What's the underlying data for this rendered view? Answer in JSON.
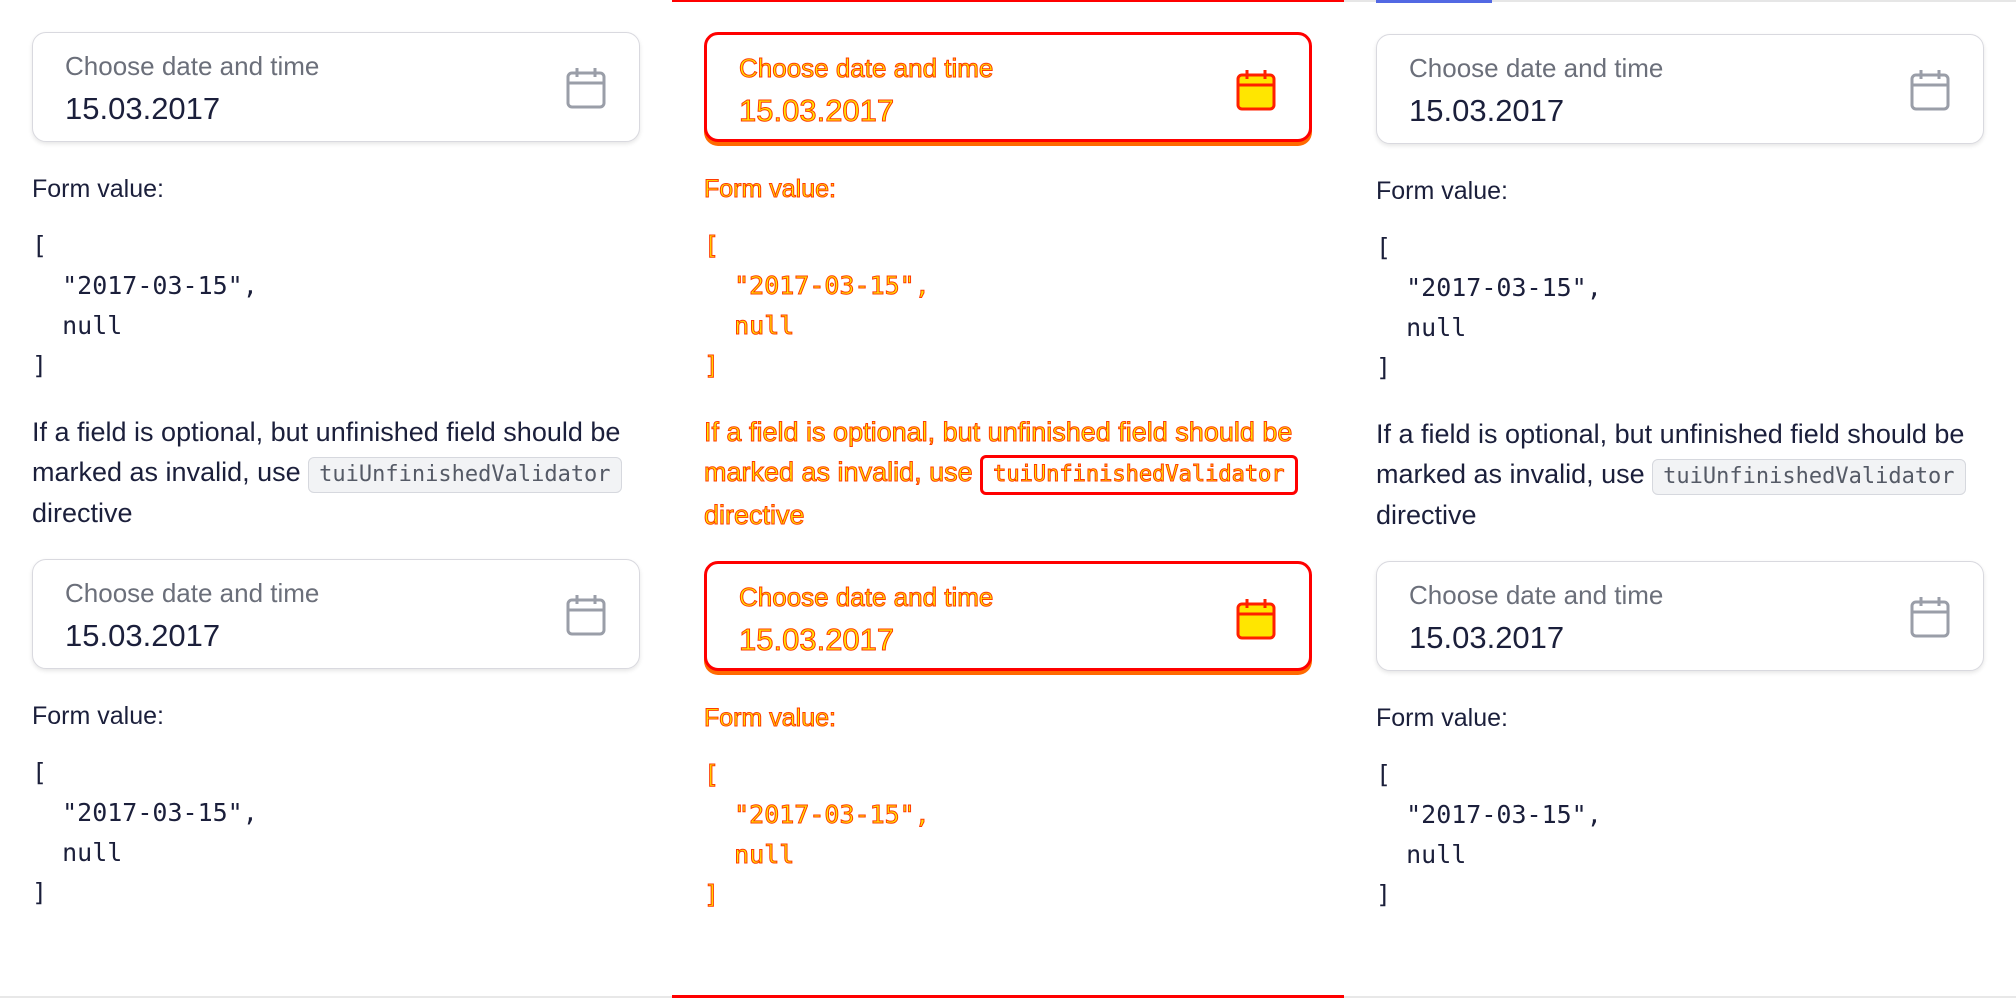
{
  "panels": [
    {
      "field1": {
        "label": "Choose date and time",
        "value": "15.03.2017",
        "icon": "calendar-icon"
      },
      "form_value_label": "Form value:",
      "json1": "[\n  \"2017-03-15\",\n  null\n]",
      "note_text": "If a field is optional, but unfinished field should be marked as invalid, use",
      "note_code": "tuiUnfinishedValidator",
      "note_suffix": "directive",
      "field2": {
        "label": "Choose date and time",
        "value": "15.03.2017",
        "icon": "calendar-icon"
      },
      "form_value_label2": "Form value:",
      "json2": "[\n  \"2017-03-15\",\n  null\n]"
    },
    {
      "field1": {
        "label": "Choose date and time",
        "value": "15.03.2017",
        "icon": "calendar-icon"
      },
      "form_value_label": "Form value:",
      "json1": "[\n  \"2017-03-15\",\n  null\n]",
      "note_text": "If a field is optional, but unfinished field should be marked as invalid, use",
      "note_code": "tuiUnfinishedValidator",
      "note_suffix": "directive",
      "field2": {
        "label": "Choose date and time",
        "value": "15.03.2017",
        "icon": "calendar-icon"
      },
      "form_value_label2": "Form value:",
      "json2": "[\n  \"2017-03-15\",\n  null\n]"
    },
    {
      "field1": {
        "label": "Choose date and time",
        "value": "15.03.2017",
        "icon": "calendar-icon"
      },
      "form_value_label": "Form value:",
      "json1": "[\n  \"2017-03-15\",\n  null\n]",
      "note_text": "If a field is optional, but unfinished field should be marked as invalid, use",
      "note_code": "tuiUnfinishedValidator",
      "note_suffix": "directive",
      "field2": {
        "label": "Choose date and time",
        "value": "15.03.2017",
        "icon": "calendar-icon"
      },
      "form_value_label2": "Form value:",
      "json2": "[\n  \"2017-03-15\",\n  null\n]"
    }
  ],
  "colors": {
    "accent": "#5268e3",
    "diff_red": "#ff0000",
    "diff_yellow": "#ffe600",
    "text": "#1b1f3b",
    "muted": "#6b6f7a"
  }
}
